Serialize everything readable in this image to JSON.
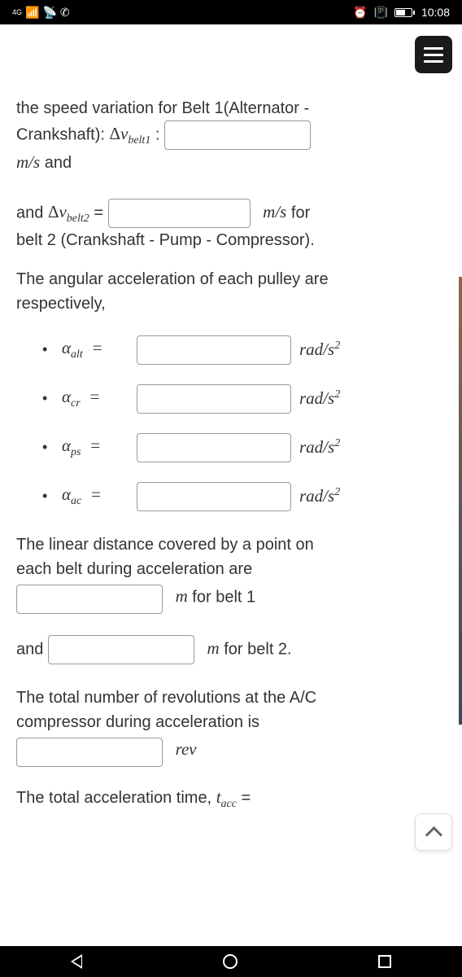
{
  "status": {
    "network": "4G",
    "time": "10:08"
  },
  "content": {
    "p1_line1": "the speed variation for Belt 1(Alternator -",
    "p1_line2_a": "Crankshaft): ",
    "dv_belt1": "Δv",
    "dv_belt1_sub": "belt1",
    "colon_space": " : ",
    "p1_line3_a": "m/s",
    "p1_line3_b": " and",
    "p2_a": "and ",
    "dv_belt2": "Δv",
    "dv_belt2_sub": "belt2",
    "equals": " = ",
    "ms_for": "m/s",
    "for_txt": " for",
    "p2_line2": "belt 2 (Crankshaft - Pump - Compressor).",
    "p3_line1": "The angular acceleration of each pulley are",
    "p3_line2": "respectively,",
    "alpha": "α",
    "alt_sub": "alt",
    "cr_sub": "cr",
    "ps_sub": "ps",
    "ac_sub": "ac",
    "rad_s2_a": "rad/s",
    "sup2": "2",
    "p4_line1": "The linear distance covered by a point on",
    "p4_line2": "each belt during acceleration are",
    "m_belt1": "m",
    "for_belt1": " for belt 1",
    "and_txt": "and ",
    "m_belt2": "m",
    "for_belt2": " for belt 2.",
    "p5_line1": "The total number of revolutions at the A/C",
    "p5_line2": "compressor during acceleration is",
    "rev_unit": "rev",
    "p6_a": "The total acceleration time, ",
    "t_sym": "t",
    "acc_sub": "acc",
    "eq2": " ="
  }
}
